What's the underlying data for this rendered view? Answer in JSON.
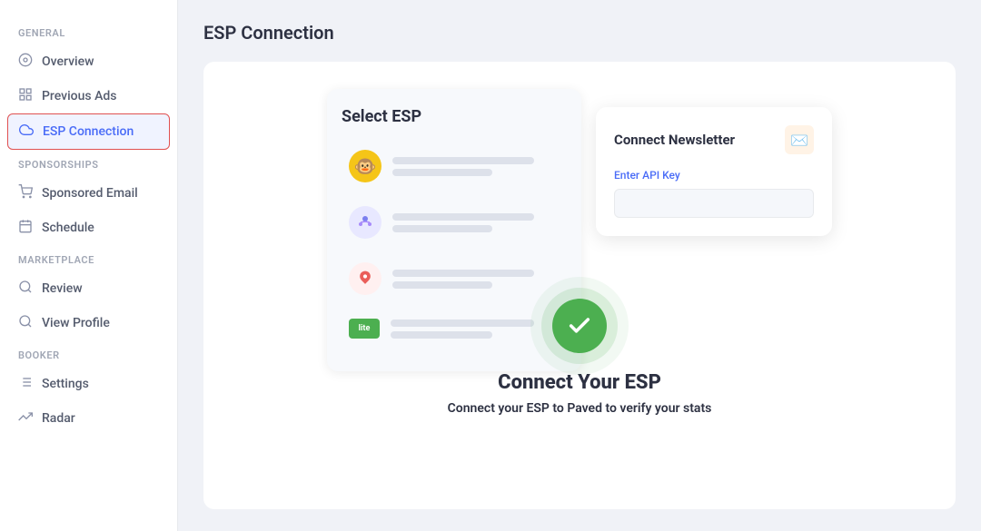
{
  "sidebar": {
    "general_label": "General",
    "sponsorships_label": "Sponsorships",
    "marketplace_label": "Marketplace",
    "booker_label": "Booker",
    "items": [
      {
        "id": "overview",
        "label": "Overview",
        "icon": "⊙",
        "active": false
      },
      {
        "id": "previous-ads",
        "label": "Previous Ads",
        "icon": "▦",
        "active": false
      },
      {
        "id": "esp-connection",
        "label": "ESP Connection",
        "icon": "☁",
        "active": true
      },
      {
        "id": "sponsored-email",
        "label": "Sponsored Email",
        "icon": "🛒",
        "active": false
      },
      {
        "id": "schedule",
        "label": "Schedule",
        "icon": "☐",
        "active": false
      },
      {
        "id": "review",
        "label": "Review",
        "icon": "🔍",
        "active": false
      },
      {
        "id": "view-profile",
        "label": "View Profile",
        "icon": "🔍",
        "active": false
      },
      {
        "id": "settings",
        "label": "Settings",
        "icon": "▤",
        "active": false
      },
      {
        "id": "radar",
        "label": "Radar",
        "icon": "◎",
        "active": false
      }
    ]
  },
  "page": {
    "title": "ESP Connection",
    "illustration": {
      "select_esp_title": "Select ESP",
      "connect_newsletter_title": "Connect Newsletter",
      "api_key_label": "Enter API Key",
      "esp_options": [
        {
          "id": "mailchimp",
          "color": "yellow"
        },
        {
          "id": "sendgrid",
          "color": "purple"
        },
        {
          "id": "klaviyo",
          "color": "red"
        },
        {
          "id": "litmus",
          "color": "green"
        }
      ]
    },
    "connect_heading": "Connect Your ESP",
    "connect_subtext": "Connect your ESP to Paved to verify your stats"
  }
}
